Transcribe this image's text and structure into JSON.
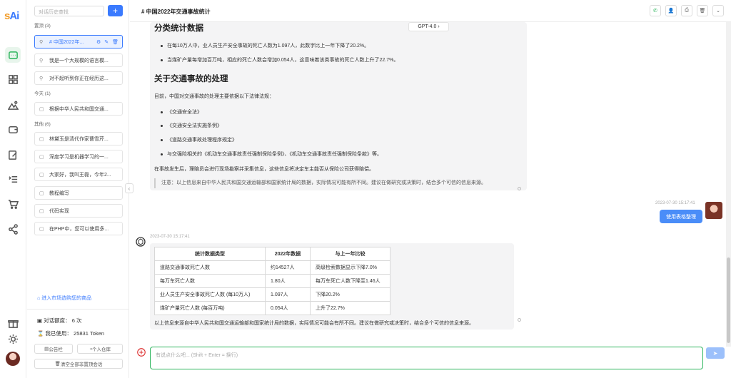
{
  "app": {
    "logo_s": "s",
    "logo_rest": "Ai"
  },
  "sidebar": {
    "search_placeholder": "对话历史查找",
    "new_label": "+",
    "groups": [
      {
        "label": "置顶 (3)"
      },
      {
        "label": "今天 (1)"
      },
      {
        "label": "其他 (6)"
      }
    ],
    "items": [
      {
        "label": "# 中国2022年..."
      },
      {
        "label": "我是一个大规模的语言模..."
      },
      {
        "label": "对不起听到你正在经历这..."
      },
      {
        "label": "根据中华人民共和国交通..."
      },
      {
        "label": "林黛玉是清代作家曹雪芹..."
      },
      {
        "label": "深度学习是机器学习的一..."
      },
      {
        "label": "大家好，我叫王磊，今年2..."
      },
      {
        "label": "教程编写"
      },
      {
        "label": "代码实现"
      },
      {
        "label": "在PHP中，您可以使用多..."
      }
    ],
    "market_link": "进入市场选购您的商品",
    "quota_label": "对话额度：",
    "quota_value": "6 次",
    "used_label": "我已使用：",
    "used_value": "25831 Token",
    "bulletin_btn": "公告栏",
    "repo_btn": "个人仓库",
    "clear_btn": "清空全部非置顶会话"
  },
  "header": {
    "title": "# 中国2022年交通事故统计"
  },
  "model": {
    "label": "GPT-4.0 ›"
  },
  "msg1": {
    "h_stats": "分类统计数据",
    "b1": "在每10万人中，业人员生产安全事故的死亡人数为1.097人，此数字比上一年下降了20.2%。",
    "b2": "当煤矿产量每增加百万吨，相应的死亡人数会增加0.054人，这意味着该类事故的死亡人数上升了22.7%。",
    "h_handle": "关于交通事故的处理",
    "intro": "目前，中国对交通事故的处理主要依据以下法律法规：",
    "laws": [
      "《交通安全法》",
      "《交通安全法实施条例》",
      "《道路交通事故处理程序规定》",
      "与交强险相关的《机动车交通事故责任强制保险条例》、《机动车交通事故责任强制保险条款》等。"
    ],
    "after": "在事故发生后，理赔员会进行现场勘察并采集信息，这些信息将决定车主能否从保险公司获得赔偿。",
    "note": "注意：以上信息来自中华人民共和国交通运输部和国家统计局的数据，实际情况可能有所不同。建议在做研究或决策时，结合多个可信的信息来源。"
  },
  "user_msg": {
    "time": "2023-07-30 15:17:41",
    "text": "使用表格整理"
  },
  "msg2": {
    "time": "2023-07-30 15:17:41",
    "headers": [
      "统计数据类型",
      "2022年数据",
      "与上一年比较"
    ],
    "rows": [
      [
        "道路交通事故死亡人数",
        "约14527人",
        "高级检索数据显示下降7.0%"
      ],
      [
        "每万车死亡人数",
        "1.80人",
        "每万车死亡人数下降至1.46人"
      ],
      [
        "业人员生产安全事故死亡人数 (每10万人)",
        "1.097人",
        "下降20.2%"
      ],
      [
        "煤矿产量死亡人数 (每百万吨)",
        "0.054人",
        "上升了22.7%"
      ]
    ],
    "note": "以上信息来源自中华人民共和国交通运输部和国家统计局的数据，实际情况可能会有所不同。建议在做研究或决策时，结合多个可信的信息来源。"
  },
  "input": {
    "placeholder": "有说点什么吧... (Shift + Enter = 换行)"
  }
}
